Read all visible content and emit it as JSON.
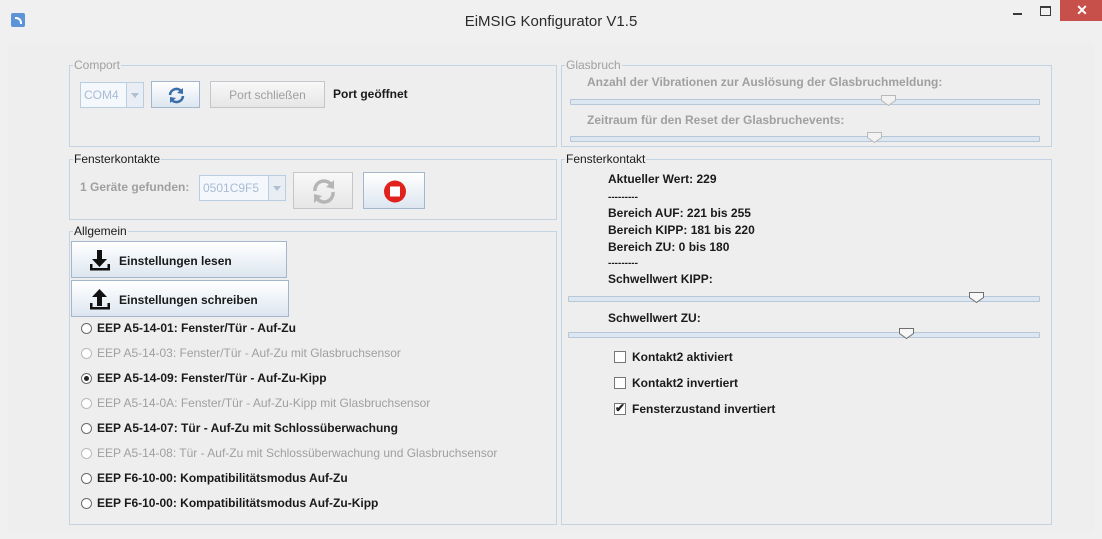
{
  "window": {
    "title": "EiMSIG Konfigurator V1.5",
    "close_glyph": "✕"
  },
  "comport": {
    "title": "Comport",
    "port_value": "COM4",
    "close_port_label": "Port schließen",
    "status": "Port geöffnet"
  },
  "glasbruch": {
    "title": "Glasbruch",
    "vibration_label": "Anzahl der Vibrationen zur Auslösung der Glasbruchmeldung:",
    "vibration_level": 0.68,
    "reset_label": "Zeitraum für den Reset der Glasbruchevents:",
    "reset_level": 0.65
  },
  "fensterkontakte": {
    "title": "Fensterkontakte",
    "found_label": "1 Geräte gefunden:",
    "device_value": "0501C9F5"
  },
  "allgemein": {
    "title": "Allgemein",
    "read_label": "Einstellungen lesen",
    "write_label": "Einstellungen schreiben",
    "options": [
      {
        "label": "EEP A5-14-01: Fenster/Tür - Auf-Zu",
        "enabled": true,
        "checked": false
      },
      {
        "label": "EEP A5-14-03: Fenster/Tür - Auf-Zu mit Glasbruchsensor",
        "enabled": false,
        "checked": false
      },
      {
        "label": "EEP A5-14-09: Fenster/Tür - Auf-Zu-Kipp",
        "enabled": true,
        "checked": true
      },
      {
        "label": "EEP A5-14-0A: Fenster/Tür - Auf-Zu-Kipp mit Glasbruchsensor",
        "enabled": false,
        "checked": false
      },
      {
        "label": "EEP A5-14-07: Tür - Auf-Zu mit Schlossüberwachung",
        "enabled": true,
        "checked": false
      },
      {
        "label": "EEP A5-14-08: Tür - Auf-Zu mit Schlossüberwachung und Glasbruchsensor",
        "enabled": false,
        "checked": false
      },
      {
        "label": "EEP F6-10-00: Kompatibilitätsmodus Auf-Zu",
        "enabled": true,
        "checked": false
      },
      {
        "label": "EEP F6-10-00: Kompatibilitätsmodus Auf-Zu-Kipp",
        "enabled": true,
        "checked": false
      }
    ]
  },
  "fensterkontakt": {
    "title": "Fensterkontakt",
    "current_value": "Aktueller Wert: 229",
    "separator1": "---------",
    "range_auf": "Bereich AUF: 221 bis 255",
    "range_kipp": "Bereich KIPP: 181 bis 220",
    "range_zu": "Bereich ZU: 0 bis 180",
    "separator2": "---------",
    "threshold_kipp_label": "Schwellwert KIPP:",
    "threshold_kipp_level": 0.87,
    "threshold_zu_label": "Schwellwert ZU:",
    "threshold_zu_level": 0.72,
    "checkboxes": [
      {
        "label": "Kontakt2 aktiviert",
        "checked": false
      },
      {
        "label": "Kontakt2 invertiert",
        "checked": false
      },
      {
        "label": "Fensterzustand invertiert",
        "checked": true
      }
    ]
  }
}
